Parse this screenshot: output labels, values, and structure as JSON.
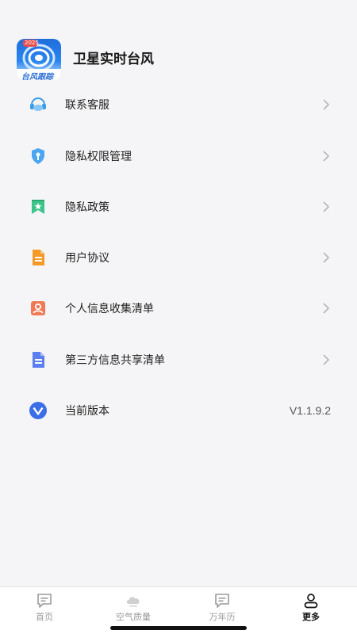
{
  "app": {
    "title": "卫星实时台风",
    "logo": {
      "badge": "2025",
      "text": "台风跟踪"
    }
  },
  "menu": {
    "items": [
      {
        "label": "联系客服",
        "icon": "customer-service-icon",
        "color": "#3a9be8"
      },
      {
        "label": "隐私权限管理",
        "icon": "privacy-shield-icon",
        "color": "#4aa6f2"
      },
      {
        "label": "隐私政策",
        "icon": "bookmark-star-icon",
        "color": "#3cc48a"
      },
      {
        "label": "用户协议",
        "icon": "document-icon",
        "color": "#f59a2a"
      },
      {
        "label": "个人信息收集清单",
        "icon": "personal-info-icon",
        "color": "#f07a56"
      },
      {
        "label": "第三方信息共享清单",
        "icon": "share-list-icon",
        "color": "#5b7ef0"
      }
    ],
    "version": {
      "label": "当前版本",
      "value": "V1.1.9.2",
      "icon": "version-v-icon",
      "color": "#3b6fe8"
    }
  },
  "tabbar": {
    "tabs": [
      {
        "label": "首页",
        "icon": "home-message-icon",
        "active": false
      },
      {
        "label": "空气质量",
        "icon": "air-quality-icon",
        "active": false
      },
      {
        "label": "万年历",
        "icon": "calendar-icon",
        "active": false
      },
      {
        "label": "更多",
        "icon": "profile-icon",
        "active": true
      }
    ]
  }
}
